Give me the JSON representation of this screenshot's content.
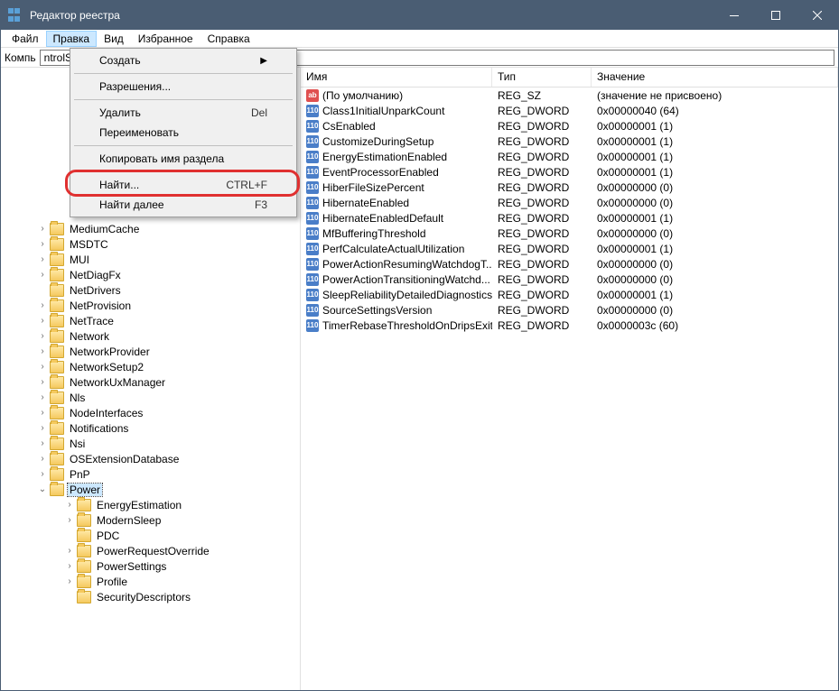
{
  "title": "Редактор реестра",
  "menubar": [
    "Файл",
    "Правка",
    "Вид",
    "Избранное",
    "Справка"
  ],
  "active_menu_index": 1,
  "addressbar": {
    "label": "Компь",
    "value": "ntrolSet\\Control\\Power"
  },
  "dropdown": {
    "items": [
      {
        "label": "Создать",
        "type": "submenu"
      },
      {
        "sep": true
      },
      {
        "label": "Разрешения..."
      },
      {
        "sep": true
      },
      {
        "label": "Удалить",
        "shortcut": "Del"
      },
      {
        "label": "Переименовать"
      },
      {
        "sep": true
      },
      {
        "label": "Копировать имя раздела"
      },
      {
        "sep": true
      },
      {
        "label": "Найти...",
        "shortcut": "CTRL+F",
        "highlighted": true
      },
      {
        "label": "Найти далее",
        "shortcut": "F3"
      }
    ]
  },
  "tree": [
    {
      "name": "MediumCache",
      "expander": ">"
    },
    {
      "name": "MSDTC",
      "expander": ">"
    },
    {
      "name": "MUI",
      "expander": ">"
    },
    {
      "name": "NetDiagFx",
      "expander": ">"
    },
    {
      "name": "NetDrivers",
      "expander": ""
    },
    {
      "name": "NetProvision",
      "expander": ">"
    },
    {
      "name": "NetTrace",
      "expander": ">"
    },
    {
      "name": "Network",
      "expander": ">"
    },
    {
      "name": "NetworkProvider",
      "expander": ">"
    },
    {
      "name": "NetworkSetup2",
      "expander": ">"
    },
    {
      "name": "NetworkUxManager",
      "expander": ">"
    },
    {
      "name": "Nls",
      "expander": ">"
    },
    {
      "name": "NodeInterfaces",
      "expander": ">"
    },
    {
      "name": "Notifications",
      "expander": ">"
    },
    {
      "name": "Nsi",
      "expander": ">"
    },
    {
      "name": "OSExtensionDatabase",
      "expander": ">"
    },
    {
      "name": "PnP",
      "expander": ">"
    },
    {
      "name": "Power",
      "expander": "v",
      "selected": true
    }
  ],
  "tree_children": [
    {
      "name": "EnergyEstimation",
      "expander": ">"
    },
    {
      "name": "ModernSleep",
      "expander": ">"
    },
    {
      "name": "PDC",
      "expander": ""
    },
    {
      "name": "PowerRequestOverride",
      "expander": ">"
    },
    {
      "name": "PowerSettings",
      "expander": ">"
    },
    {
      "name": "Profile",
      "expander": ">"
    },
    {
      "name": "SecurityDescriptors",
      "expander": ""
    }
  ],
  "list_headers": {
    "name": "Имя",
    "type": "Тип",
    "value": "Значение"
  },
  "list": [
    {
      "icon": "sz",
      "name": "(По умолчанию)",
      "type": "REG_SZ",
      "value": "(значение не присвоено)"
    },
    {
      "icon": "dw",
      "name": "Class1InitialUnparkCount",
      "type": "REG_DWORD",
      "value": "0x00000040 (64)"
    },
    {
      "icon": "dw",
      "name": "CsEnabled",
      "type": "REG_DWORD",
      "value": "0x00000001 (1)"
    },
    {
      "icon": "dw",
      "name": "CustomizeDuringSetup",
      "type": "REG_DWORD",
      "value": "0x00000001 (1)"
    },
    {
      "icon": "dw",
      "name": "EnergyEstimationEnabled",
      "type": "REG_DWORD",
      "value": "0x00000001 (1)"
    },
    {
      "icon": "dw",
      "name": "EventProcessorEnabled",
      "type": "REG_DWORD",
      "value": "0x00000001 (1)"
    },
    {
      "icon": "dw",
      "name": "HiberFileSizePercent",
      "type": "REG_DWORD",
      "value": "0x00000000 (0)"
    },
    {
      "icon": "dw",
      "name": "HibernateEnabled",
      "type": "REG_DWORD",
      "value": "0x00000000 (0)"
    },
    {
      "icon": "dw",
      "name": "HibernateEnabledDefault",
      "type": "REG_DWORD",
      "value": "0x00000001 (1)"
    },
    {
      "icon": "dw",
      "name": "MfBufferingThreshold",
      "type": "REG_DWORD",
      "value": "0x00000000 (0)"
    },
    {
      "icon": "dw",
      "name": "PerfCalculateActualUtilization",
      "type": "REG_DWORD",
      "value": "0x00000001 (1)"
    },
    {
      "icon": "dw",
      "name": "PowerActionResumingWatchdogT...",
      "type": "REG_DWORD",
      "value": "0x00000000 (0)"
    },
    {
      "icon": "dw",
      "name": "PowerActionTransitioningWatchd...",
      "type": "REG_DWORD",
      "value": "0x00000000 (0)"
    },
    {
      "icon": "dw",
      "name": "SleepReliabilityDetailedDiagnostics",
      "type": "REG_DWORD",
      "value": "0x00000001 (1)"
    },
    {
      "icon": "dw",
      "name": "SourceSettingsVersion",
      "type": "REG_DWORD",
      "value": "0x00000000 (0)"
    },
    {
      "icon": "dw",
      "name": "TimerRebaseThresholdOnDripsExit",
      "type": "REG_DWORD",
      "value": "0x0000003c (60)"
    }
  ]
}
